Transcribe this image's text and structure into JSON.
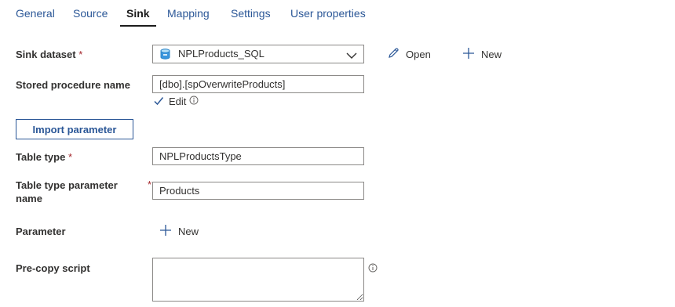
{
  "tabs": [
    {
      "label": "General"
    },
    {
      "label": "Source"
    },
    {
      "label": "Sink"
    },
    {
      "label": "Mapping"
    },
    {
      "label": "Settings"
    },
    {
      "label": "User properties"
    }
  ],
  "sink_dataset": {
    "label": "Sink dataset",
    "required_mark": "*",
    "value": "NPLProducts_SQL",
    "open_label": "Open",
    "new_label": "New"
  },
  "stored_procedure": {
    "label": "Stored procedure name",
    "value": "[dbo].[spOverwriteProducts]",
    "edit_label": "Edit",
    "edit_checked": true
  },
  "import_parameter_label": "Import parameter",
  "table_type": {
    "label": "Table type",
    "required_mark": "*",
    "value": "NPLProductsType"
  },
  "table_type_param": {
    "label_line1": "Table type parameter",
    "label_line2": "name",
    "required_mark": "*",
    "value": "Products"
  },
  "parameter": {
    "label": "Parameter",
    "new_label": "New"
  },
  "pre_copy_script": {
    "label": "Pre-copy script",
    "value": ""
  },
  "colors": {
    "accent": "#2b5797",
    "required": "#a4262c",
    "border": "#8a8886"
  }
}
